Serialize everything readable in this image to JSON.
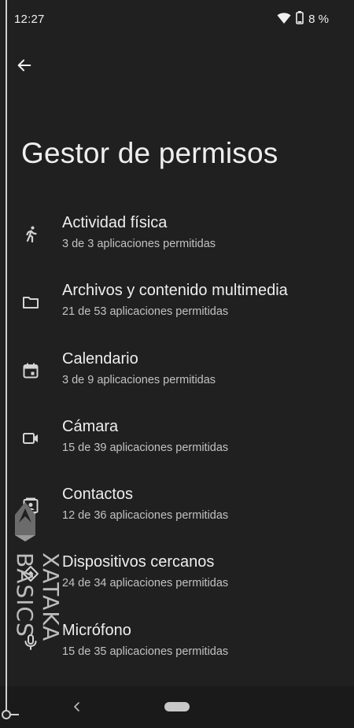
{
  "status_bar": {
    "time": "12:27",
    "battery": "8 %",
    "icons": [
      "wifi-icon",
      "battery-icon"
    ]
  },
  "header": {
    "back_icon": "arrow-left-icon",
    "title": "Gestor de permisos"
  },
  "permissions": [
    {
      "icon": "running-person-icon",
      "title": "Actividad física",
      "subtitle": "3 de 3 aplicaciones permitidas"
    },
    {
      "icon": "folder-icon",
      "title": "Archivos y contenido multimedia",
      "subtitle": "21 de 53 aplicaciones permitidas"
    },
    {
      "icon": "calendar-icon",
      "title": "Calendario",
      "subtitle": "3 de 9 aplicaciones permitidas"
    },
    {
      "icon": "video-camera-icon",
      "title": "Cámara",
      "subtitle": "15 de 39 aplicaciones permitidas"
    },
    {
      "icon": "contact-card-icon",
      "title": "Contactos",
      "subtitle": "12 de 36 aplicaciones permitidas"
    },
    {
      "icon": "nearby-devices-icon",
      "title": "Dispositivos cercanos",
      "subtitle": "24 de 34 aplicaciones permitidas"
    },
    {
      "icon": "microphone-icon",
      "title": "Micrófono",
      "subtitle": "15 de 35 aplicaciones permitidas"
    }
  ],
  "nav_bar": {
    "back_icon": "chevron-left-icon",
    "home_icon": "home-pill-icon"
  },
  "watermark": {
    "text": "XATAKA BASICS"
  },
  "colors": {
    "background": "#1f201f",
    "nav_background": "#191a19",
    "text_primary": "#eeeeee",
    "text_secondary": "#c2c2c2"
  }
}
